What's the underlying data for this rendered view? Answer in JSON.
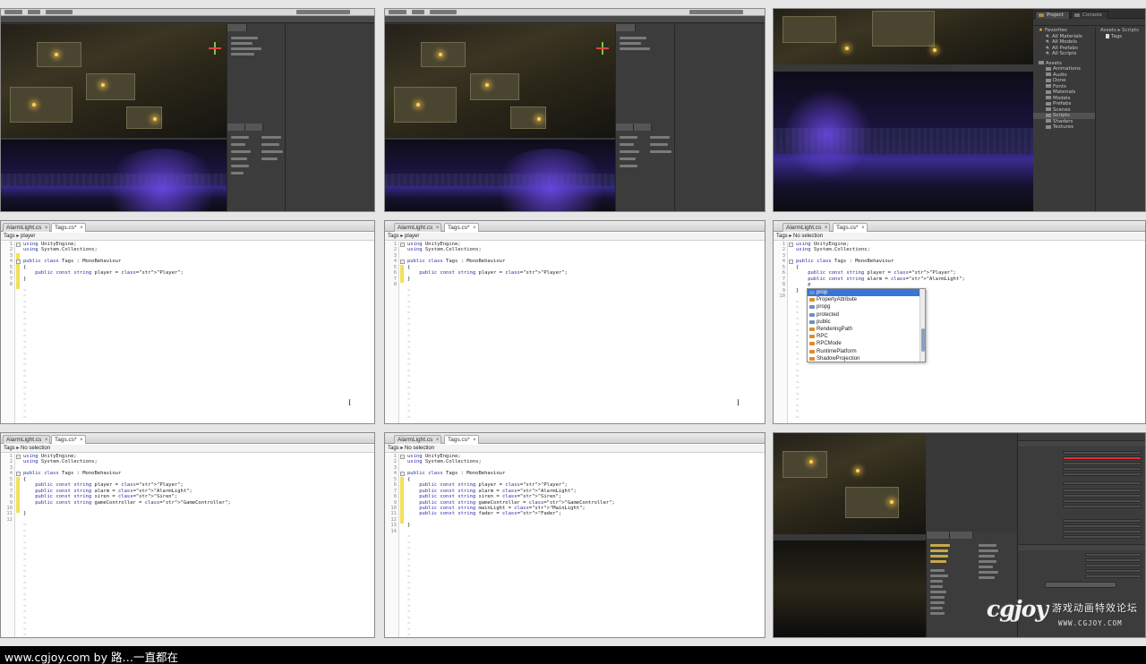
{
  "tiles": {
    "t3_project": {
      "tabs": [
        "Project",
        "Console"
      ],
      "favorites_label": "Favorites",
      "favorites": [
        "All Materials",
        "All Models",
        "All Prefabs",
        "All Scripts"
      ],
      "assets_label": "Assets",
      "folders": [
        "Animations",
        "Audio",
        "Done",
        "Fonts",
        "Materials",
        "Models",
        "Prefabs",
        "Scenes",
        "Scripts",
        "Shaders",
        "Textures"
      ],
      "selected_folder": "Scripts",
      "breadcrumb": "Assets ▸ Scripts",
      "files": [
        "Tags"
      ]
    },
    "t4": {
      "tabs": [
        "AlarmLight.cs",
        "Tags.cs*"
      ],
      "crumb": "Tags ▸ player",
      "lines": [
        "using UnityEngine;",
        "using System.Collections;",
        "",
        "public class Tags : MonoBehaviour",
        "{",
        "    public const string player = \"Player\";",
        "}",
        ""
      ]
    },
    "t5": {
      "tabs": [
        "AlarmLight.cs",
        "Tags.cs*"
      ],
      "crumb": "Tags ▸ player",
      "lines": [
        "using UnityEngine;",
        "using System.Collections;",
        "",
        "public class Tags : MonoBehaviour",
        "{",
        "    public const string player = \"Player\";",
        "}",
        ""
      ]
    },
    "t6": {
      "tabs": [
        "AlarmLight.cs",
        "Tags.cs*"
      ],
      "crumb": "Tags ▸ No selection",
      "lines": [
        "using UnityEngine;",
        "using System.Collections;",
        "",
        "public class Tags : MonoBehaviour",
        "{",
        "    public const string player = \"Player\";",
        "    public const string alarm = \"AlarmLight\";",
        "    p",
        "}",
        ""
      ],
      "autocomplete": [
        "prop",
        "PropertyAttribute",
        "propg",
        "protected",
        "public",
        "RenderingPath",
        "RPC",
        "RPCMode",
        "RuntimePlatform",
        "ShadowProjection"
      ],
      "autocomplete_selected": "prop"
    },
    "t7": {
      "tabs": [
        "AlarmLight.cs",
        "Tags.cs*"
      ],
      "crumb": "Tags ▸ No selection",
      "lines": [
        "using UnityEngine;",
        "using System.Collections;",
        "",
        "public class Tags : MonoBehaviour",
        "{",
        "    public const string player = \"Player\";",
        "    public const string alarm = \"AlarmLight\";",
        "    public const string siren = \"Siren\";",
        "    public const string gameController = \"GameController\";",
        "    ",
        "}",
        ""
      ]
    },
    "t8": {
      "tabs": [
        "AlarmLight.cs",
        "Tags.cs*"
      ],
      "crumb": "Tags ▸ No selection",
      "lines": [
        "using UnityEngine;",
        "using System.Collections;",
        "",
        "public class Tags : MonoBehaviour",
        "{",
        "    public const string player = \"Player\";",
        "    public const string alarm = \"AlarmLight\";",
        "    public const string siren = \"Siren\";",
        "    public const string gameController = \"GameController\";",
        "    public const string mainLight = \"MainLight\";",
        "    public const string fader = \"Fader\";",
        "    ",
        "}",
        ""
      ]
    }
  },
  "watermark": {
    "logo": "cgjoy",
    "cn": "游戏动画特效论坛",
    "url": "WWW.CGJOY.COM"
  },
  "footer": "www.cgjoy.com by 路…一直都在"
}
